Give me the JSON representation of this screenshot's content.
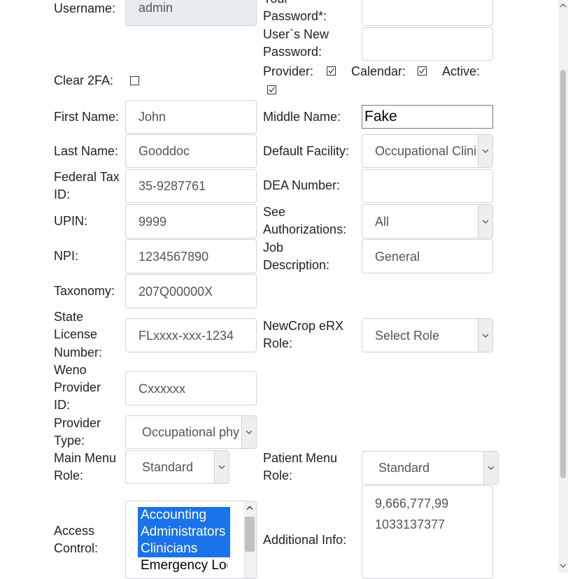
{
  "fields": {
    "username": {
      "label": "Username:",
      "value": "admin"
    },
    "your_password": {
      "label_line1": "Your",
      "label_line2": "Password*:",
      "value": ""
    },
    "new_password": {
      "label_line1": "User`s New",
      "label_line2": "Password:",
      "value": ""
    },
    "clear_2fa": {
      "label": "Clear 2FA:",
      "checked": false
    },
    "provider": {
      "label": "Provider:",
      "checked": true
    },
    "calendar": {
      "label": "Calendar:",
      "checked": true
    },
    "active": {
      "label": "Active:",
      "checked": true
    },
    "first_name": {
      "label": "First Name:",
      "value": "John"
    },
    "middle_name": {
      "label": "Middle Name:",
      "value": "Fake"
    },
    "last_name": {
      "label": "Last Name:",
      "value": "Gooddoc"
    },
    "default_facility": {
      "label": "Default Facility:",
      "value": "Occupational Clinic"
    },
    "federal_tax_id": {
      "label_line1": "Federal Tax",
      "label_line2": "ID:",
      "value": "35-9287761"
    },
    "dea_number": {
      "label": "DEA Number:",
      "value": ""
    },
    "upin": {
      "label": "UPIN:",
      "value": "9999"
    },
    "see_authorizations": {
      "label_line1": "See",
      "label_line2": "Authorizations:",
      "value": "All"
    },
    "npi": {
      "label": "NPI:",
      "value": "1234567890"
    },
    "job_description": {
      "label_line1": "Job",
      "label_line2": "Description:",
      "value": "General"
    },
    "taxonomy": {
      "label": "Taxonomy:",
      "value": "207Q00000X"
    },
    "state_license": {
      "label_line1": "State",
      "label_line2": "License",
      "label_line3": "Number:",
      "value": "FLxxxx-xxx-1234"
    },
    "newcrop_role": {
      "label_line1": "NewCrop eRX",
      "label_line2": "Role:",
      "value": "Select Role"
    },
    "weno_provider_id": {
      "label_line1": "Weno",
      "label_line2": "Provider",
      "label_line3": "ID:",
      "value": "Cxxxxxx"
    },
    "provider_type": {
      "label_line1": "Provider",
      "label_line2": "Type:",
      "value": "Occupational physician"
    },
    "main_menu_role": {
      "label_line1": "Main Menu",
      "label_line2": "Role:",
      "value": "Standard"
    },
    "patient_menu_role": {
      "label_line1": "Patient Menu",
      "label_line2": "Role:",
      "value": "Standard"
    },
    "access_control": {
      "label_line1": "Access",
      "label_line2": "Control:",
      "options": [
        "Accounting",
        "Administrators",
        "Clinicians",
        "Emergency Login"
      ]
    },
    "additional_info": {
      "label": "Additional Info:",
      "line1": "9,666,777,99",
      "line2": "1033137377"
    }
  },
  "icons": {
    "check": "check-icon",
    "caret": "chevron-down-icon"
  }
}
